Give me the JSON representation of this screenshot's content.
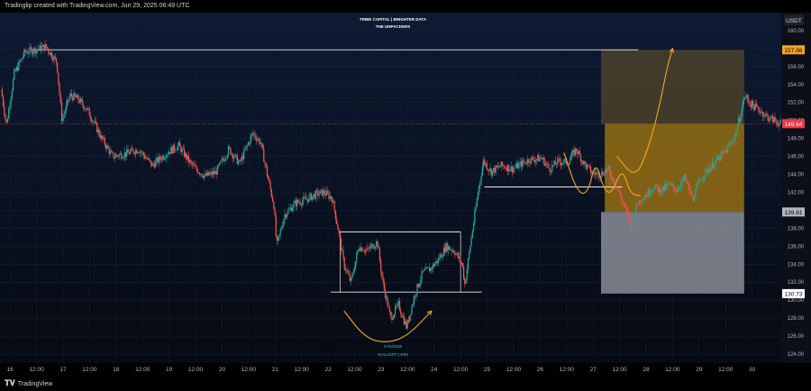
{
  "header": {
    "attribution": "Tradinglip created with TradingView.com, Jun 29, 2025 06:49 UTC"
  },
  "currency_badge": "USDT",
  "overlay_text": {
    "title_line1": "TRIBE CAPITAL | BRIGHTER DATA",
    "title_line2": "THE UNPACKERS"
  },
  "annotation": {
    "line1": "27/6/2025",
    "line2": "SOLUSDT | 30M"
  },
  "price_labels": {
    "target": {
      "value": "157.86",
      "color": "#f5a623"
    },
    "current": {
      "value": "149.64",
      "color": "#f23645"
    },
    "entry": {
      "value": "139.81",
      "color": "#b2b5be"
    },
    "stop": {
      "value": "130.73",
      "color": "#ffffff"
    }
  },
  "footer": {
    "brand": "TradingView",
    "logo_icon": "tradingview-logo-icon"
  },
  "chart_data": {
    "type": "candlestick",
    "symbol": "SOLUSDT",
    "interval": "30M",
    "currency": "USDT",
    "ylim": [
      123,
      162
    ],
    "y_ticks": [
      "124.00",
      "126.00",
      "128.00",
      "130.00",
      "132.00",
      "134.00",
      "136.00",
      "138.00",
      "140.00",
      "142.00",
      "144.00",
      "146.00",
      "148.00",
      "150.00",
      "152.00",
      "154.00",
      "156.00",
      "158.00",
      "160.00"
    ],
    "x_ticks": [
      "16",
      "12:00",
      "17",
      "12:00",
      "18",
      "12:00",
      "19",
      "12:00",
      "20",
      "12:00",
      "21",
      "12:00",
      "22",
      "12:00",
      "23",
      "12:00",
      "24",
      "12:00",
      "25",
      "12:00",
      "26",
      "12:00",
      "27",
      "12:00",
      "28",
      "12:00",
      "29",
      "12:00",
      "30"
    ],
    "x_tick_positions_days": [
      0,
      0.5,
      1,
      1.5,
      2,
      2.5,
      3,
      3.5,
      4,
      4.5,
      5,
      5.5,
      6,
      6.5,
      7,
      7.5,
      8,
      8.5,
      9,
      9.5,
      10,
      10.5,
      11,
      11.5,
      12,
      12.5,
      13,
      13.5,
      14
    ],
    "x_range_days": [
      -0.19,
      14.55
    ],
    "price_path": [
      [
        -0.15,
        153.5
      ],
      [
        -0.05,
        149.5
      ],
      [
        0.1,
        155.2
      ],
      [
        0.3,
        157.6
      ],
      [
        0.5,
        157.9
      ],
      [
        0.7,
        158.2
      ],
      [
        0.9,
        156.5
      ],
      [
        1.0,
        150.0
      ],
      [
        1.15,
        152.8
      ],
      [
        1.3,
        152.4
      ],
      [
        1.5,
        151.0
      ],
      [
        1.75,
        148.0
      ],
      [
        1.95,
        146.0
      ],
      [
        2.2,
        146.3
      ],
      [
        2.45,
        146.8
      ],
      [
        2.7,
        145.0
      ],
      [
        3.0,
        146.5
      ],
      [
        3.2,
        147.2
      ],
      [
        3.45,
        145.0
      ],
      [
        3.7,
        143.8
      ],
      [
        3.9,
        144.2
      ],
      [
        4.15,
        146.8
      ],
      [
        4.35,
        145.2
      ],
      [
        4.6,
        148.6
      ],
      [
        4.75,
        147.5
      ],
      [
        4.9,
        143.2
      ],
      [
        5.0,
        140.5
      ],
      [
        5.05,
        136.0
      ],
      [
        5.2,
        139.5
      ],
      [
        5.4,
        140.8
      ],
      [
        5.6,
        141.2
      ],
      [
        5.8,
        141.8
      ],
      [
        5.95,
        142.0
      ],
      [
        6.1,
        141.3
      ],
      [
        6.2,
        138.2
      ],
      [
        6.32,
        134.0
      ],
      [
        6.45,
        132.0
      ],
      [
        6.6,
        136.0
      ],
      [
        6.75,
        135.5
      ],
      [
        6.95,
        136.5
      ],
      [
        7.05,
        132.0
      ],
      [
        7.2,
        128.0
      ],
      [
        7.35,
        129.5
      ],
      [
        7.5,
        127.0
      ],
      [
        7.65,
        130.5
      ],
      [
        7.8,
        133.0
      ],
      [
        7.95,
        133.5
      ],
      [
        8.1,
        134.5
      ],
      [
        8.25,
        136.0
      ],
      [
        8.4,
        135.5
      ],
      [
        8.55,
        134.0
      ],
      [
        8.6,
        131.8
      ],
      [
        8.75,
        138.0
      ],
      [
        8.85,
        142.0
      ],
      [
        8.95,
        145.5
      ],
      [
        9.1,
        144.3
      ],
      [
        9.3,
        145.0
      ],
      [
        9.5,
        144.6
      ],
      [
        9.8,
        145.6
      ],
      [
        10.05,
        145.8
      ],
      [
        10.2,
        144.6
      ],
      [
        10.35,
        145.4
      ],
      [
        10.55,
        145.4
      ],
      [
        10.7,
        146.8
      ],
      [
        10.85,
        145.2
      ],
      [
        11.0,
        144.2
      ],
      [
        11.15,
        144.0
      ],
      [
        11.3,
        144.6
      ],
      [
        11.45,
        142.8
      ],
      [
        11.6,
        140.6
      ],
      [
        11.75,
        138.2
      ],
      [
        11.85,
        140.8
      ],
      [
        12.0,
        141.6
      ],
      [
        12.15,
        142.6
      ],
      [
        12.3,
        142.2
      ],
      [
        12.45,
        142.8
      ],
      [
        12.6,
        142.3
      ],
      [
        12.75,
        143.6
      ],
      [
        12.9,
        141.2
      ],
      [
        13.05,
        143.6
      ],
      [
        13.2,
        144.6
      ],
      [
        13.4,
        145.8
      ],
      [
        13.55,
        146.8
      ],
      [
        13.7,
        148.3
      ],
      [
        13.8,
        150.6
      ],
      [
        13.88,
        152.8
      ],
      [
        14.0,
        151.8
      ],
      [
        14.15,
        151.2
      ],
      [
        14.3,
        150.4
      ],
      [
        14.45,
        150.0
      ],
      [
        14.55,
        149.64
      ]
    ],
    "levels": {
      "top_resistance": {
        "price": 157.86,
        "from_day": 0.4,
        "to_day": 11.85
      },
      "box_high": {
        "price": 137.6,
        "from_day": 6.2,
        "to_day": 8.5
      },
      "box_low": {
        "price": 130.9,
        "from_day": 6.05,
        "to_day": 8.9
      },
      "range_line": {
        "price": 142.6,
        "from_day": 8.95,
        "to_day": 11.55
      },
      "current_price": 149.64
    },
    "position": {
      "from_day": 11.15,
      "to_day": 13.85,
      "entry": 139.81,
      "target": 157.86,
      "stop": 130.73,
      "midline": 149.64
    },
    "projections": [
      {
        "name": "bullish-path",
        "points": [
          [
            11.45,
            146.0
          ],
          [
            11.8,
            143.5
          ],
          [
            12.05,
            147.0
          ],
          [
            12.25,
            151.5
          ],
          [
            12.4,
            156.0
          ],
          [
            12.5,
            158.0
          ]
        ]
      },
      {
        "name": "chop-path",
        "points": [
          [
            10.45,
            146.4
          ],
          [
            10.7,
            142.0
          ],
          [
            10.9,
            141.8
          ],
          [
            11.05,
            145.6
          ],
          [
            11.2,
            142.3
          ],
          [
            11.35,
            141.8
          ],
          [
            11.55,
            144.8
          ],
          [
            11.7,
            141.8
          ],
          [
            11.9,
            141.6
          ]
        ]
      },
      {
        "name": "cup-curve",
        "points": [
          [
            6.3,
            128.8
          ],
          [
            6.7,
            125.8
          ],
          [
            7.1,
            125.2
          ],
          [
            7.5,
            126.0
          ],
          [
            7.95,
            128.8
          ]
        ]
      }
    ]
  }
}
